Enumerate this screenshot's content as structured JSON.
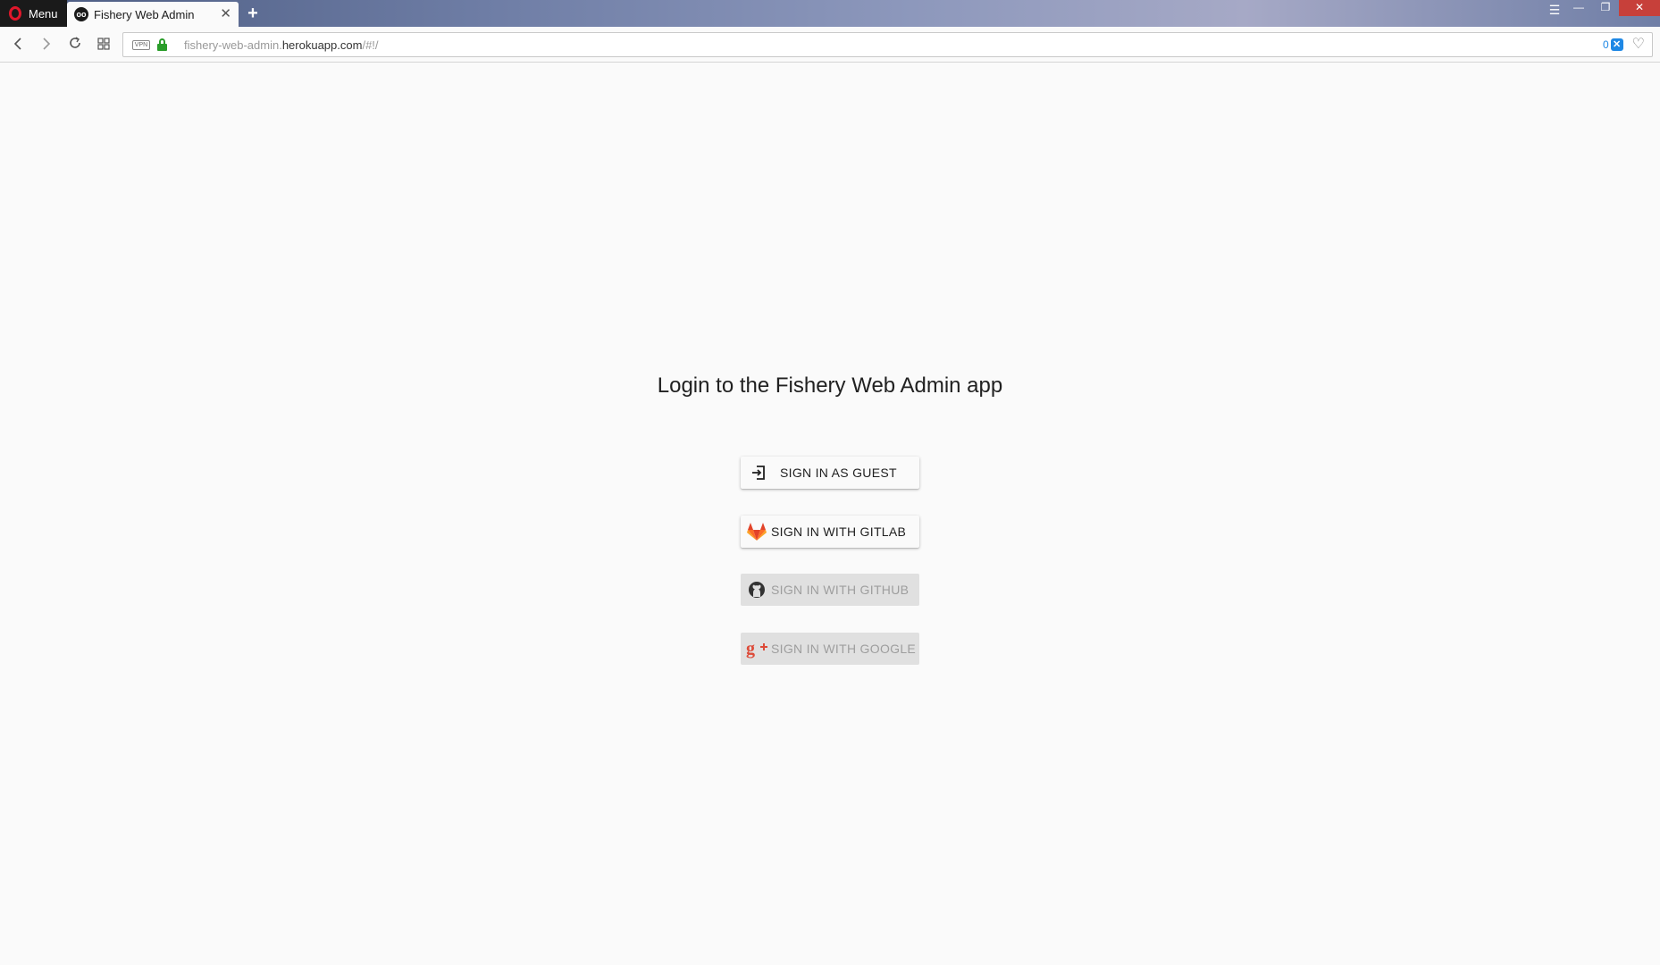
{
  "browser": {
    "menu_label": "Menu",
    "tab_title": "Fishery Web Admin",
    "tab_favicon": "oo",
    "tab_close": "✕",
    "new_tab": "+",
    "url_protocol_prefix": "fishery-web-admin.",
    "url_host": "herokuapp.com",
    "url_path": "/#!/",
    "vpn_label": "VPN",
    "blocked_count": "0",
    "window_buttons": [
      "—",
      "❐",
      "✕"
    ]
  },
  "page": {
    "title": "Login to the Fishery Web Admin app",
    "buttons": [
      {
        "label": "SIGN IN AS GUEST",
        "icon": "sign-in-icon",
        "enabled": true
      },
      {
        "label": "SIGN IN WITH GITLAB",
        "icon": "gitlab-icon",
        "enabled": true
      },
      {
        "label": "SIGN IN WITH GITHUB",
        "icon": "github-icon",
        "enabled": false
      },
      {
        "label": "SIGN IN WITH GOOGLE",
        "icon": "google-plus-icon",
        "enabled": false
      }
    ]
  },
  "colors": {
    "page_bg": "#fafafa",
    "gitlab_orange": "#e24329",
    "google_red": "#dd4b39",
    "lock_green": "#2a9d2a",
    "blocker_blue": "#1e88e5",
    "disabled_bg": "#e0e0e0",
    "disabled_text": "#9e9e9e"
  }
}
